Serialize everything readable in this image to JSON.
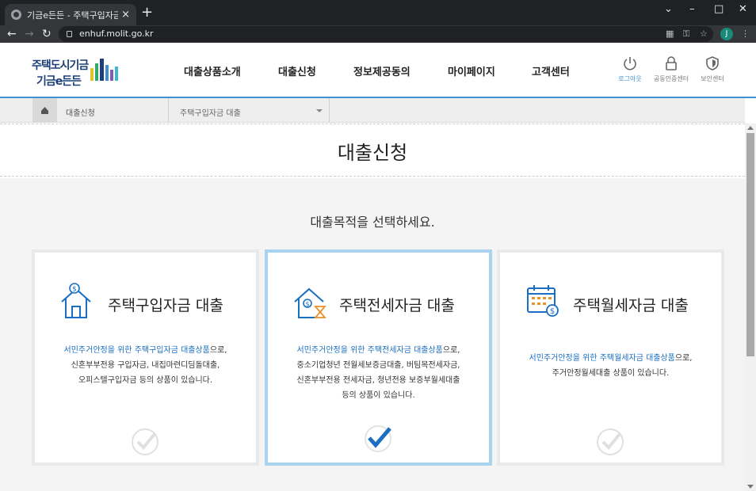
{
  "browser": {
    "tab_title": "기금e든든 - 주택구입자금 대출",
    "tab_close": "×",
    "new_tab": "+",
    "url": "enhuf.molit.go.kr",
    "profile_initial": "J",
    "window_controls": [
      "⌄",
      "–",
      "□",
      "✕"
    ]
  },
  "header": {
    "logo_line1": "주택도시기금",
    "logo_line2": "기금e든든",
    "menu": [
      "대출상품소개",
      "대출신청",
      "정보제공동의",
      "마이페이지",
      "고객센터"
    ],
    "utils": [
      {
        "label": "로그아웃",
        "icon": "power-icon",
        "active": true
      },
      {
        "label": "공동인증센터",
        "icon": "lock-icon",
        "active": false
      },
      {
        "label": "보안센터",
        "icon": "shield-icon",
        "active": false
      }
    ],
    "accent_color": "#3f8fd4"
  },
  "breadcrumb": {
    "home_icon": "home-icon",
    "level1": "대출신청",
    "select_value": "주택구입자금 대출"
  },
  "page": {
    "title": "대출신청",
    "subtitle": "대출목적을 선택하세요."
  },
  "cards": [
    {
      "title": "주택구입자금 대출",
      "icon": "house-dollar-icon",
      "desc_hl": "서민주거안정을 위한 주택구입자금 대출상품",
      "desc_rest": "으로,",
      "desc_lines": [
        "신혼부부전용 구입자금, 내집마련디딤돌대출,",
        "오피스텔구입자금 등의 상품이 있습니다."
      ],
      "selected": false
    },
    {
      "title": "주택전세자금 대출",
      "icon": "house-hourglass-icon",
      "desc_hl": "서민주거안정을 위한 주택전세자금 대출상품",
      "desc_rest": "으로,",
      "desc_lines": [
        "중소기업청년 전월세보증금대출, 버팀목전세자금,",
        "신혼부부전용 전세자금, 청년전용 보증부월세대출",
        "등의 상품이 있습니다."
      ],
      "selected": true
    },
    {
      "title": "주택월세자금 대출",
      "icon": "calendar-dollar-icon",
      "desc_hl": "서민주거안정을 위한 주택월세자금 대출상품",
      "desc_rest": "으로,",
      "desc_lines": [
        "주거안정월세대출 상품이 있습니다."
      ],
      "selected": false
    }
  ]
}
